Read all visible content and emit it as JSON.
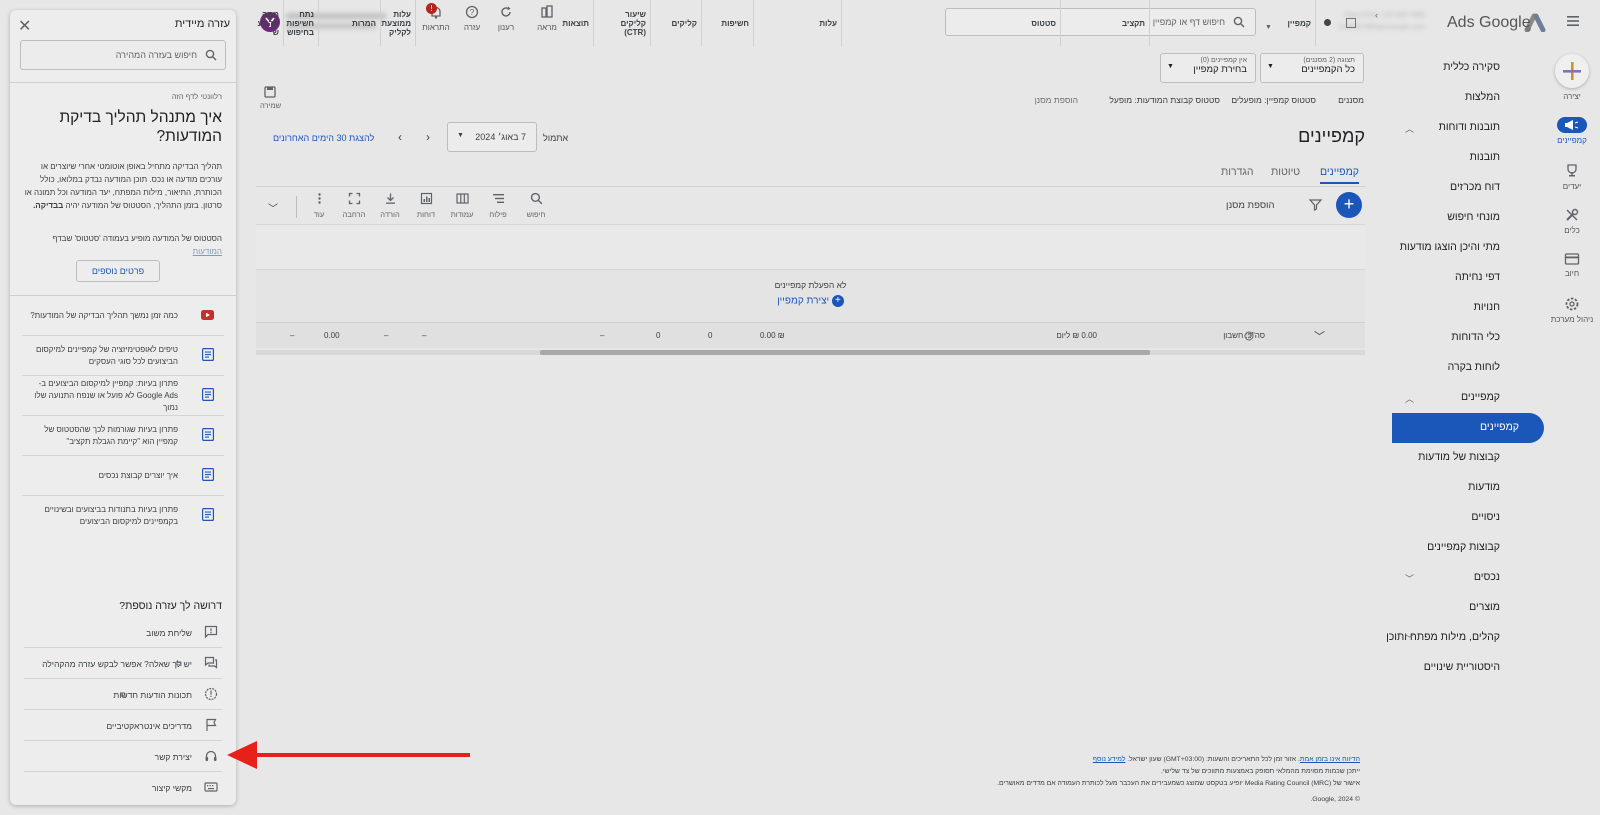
{
  "brand": {
    "name": "Ads Google"
  },
  "account": {
    "masked_line1": "Oreo1234 • 123-456-7890",
    "masked_line2": "1234567890@example.com"
  },
  "search": {
    "placeholder": "חיפוש דף או קמפיין"
  },
  "top_actions": [
    {
      "label": "מראה",
      "icon": "appearance-icon"
    },
    {
      "label": "רענון",
      "icon": "refresh-icon"
    },
    {
      "label": "עזרה",
      "icon": "help-icon"
    },
    {
      "label": "התראות",
      "icon": "bell-icon"
    }
  ],
  "rail": [
    {
      "label": "יצירה",
      "icon": "plus-icon"
    },
    {
      "label": "קמפיינים",
      "icon": "campaigns-icon"
    },
    {
      "label": "יעדים",
      "icon": "trophy-icon"
    },
    {
      "label": "כלים",
      "icon": "tools-icon"
    },
    {
      "label": "חיוב",
      "icon": "card-icon"
    },
    {
      "label": "ניהול מערכת",
      "icon": "gear-icon"
    }
  ],
  "nav": [
    "סקירה כללית",
    "המלצות",
    "תובנות ודוחות",
    "תובנות",
    "דוח מכרזים",
    "מונחי חיפוש",
    "מתי והיכן הוצגו מודעות",
    "דפי נחיתה",
    "חנויות",
    "כלי הדוחות",
    "לוחות בקרה",
    "קמפיינים",
    "קמפיינים",
    "קבוצות של מודעות",
    "מודעות",
    "ניסויים",
    "קבוצות קמפיינים",
    "נכסים",
    "מוצרים",
    "קהלים, מילות מפתח ותוכן",
    "היסטוריית שינויים"
  ],
  "chips": {
    "view_small": "תצוגה (2 מסננים)",
    "view_main": "כל הקמפיינים",
    "campaign_small": "אין קמפיינים (0)",
    "campaign_main": "בחירת קמפיין"
  },
  "filters": {
    "label": "מסננים",
    "f1": "סטטוס קמפיין: מופעלים",
    "f2": "סטטוס קבוצת המודעות: מופעל",
    "add": "הוספת מסנן"
  },
  "save": {
    "label": "שמירה"
  },
  "page": {
    "title": "קמפיינים"
  },
  "date": {
    "label": "אתמול",
    "value": "7 באוג׳ 2024",
    "compare": "להצגת 30 הימים האחרונים"
  },
  "tabs": [
    "קמפיינים",
    "טיוטות",
    "הגדרות"
  ],
  "toolbar": {
    "add_filter": "הוספת מסנן",
    "buttons": [
      "חיפוש",
      "פילוח",
      "עמודות",
      "דוחות",
      "הורדה",
      "הרחבה",
      "עוד"
    ]
  },
  "table": {
    "columns": [
      "קמפיין",
      "תקציב",
      "סטטוס",
      "עלות",
      "חשיפות",
      "קליקים",
      "שיעור קליקים (CTR)",
      "תוצאות",
      "עלות ממוצעת לקליק",
      "המרות",
      "נתח חשיפות בחיפוש",
      "ממה ההתע ש"
    ],
    "empty_text": "לא הפעלת קמפיינים",
    "create_link": "יצירת קמפיין",
    "total": {
      "label": "סה\"כ: חשבון",
      "budget": "0.00 ₪ ליום",
      "cost": "₪ 0.00",
      "impressions": "0",
      "clicks": "0",
      "ctr": "–",
      "results": "–",
      "avg_cpc": "–",
      "conversions": "0.00",
      "impr_share": "–"
    }
  },
  "footer": {
    "line1_link": "הדיווח אינו בזמן אמת",
    "line1": ". אזור זמן לכל התאריכים והשעות: (GMT+03:00) שעון ישראל.",
    "line1_more": "למידע נוסף",
    "line2": "ייתכן שכמות מסוימת מהמלאי תסופק באמצעות מתווכים של צד שלישי.",
    "line3": "אישור של (MRC) Media Rating Council יופיע בטקסט שמוצג כשמעבירים את העכבר מעל לכותרת העמודה אם מדדים מאושרים.",
    "copyright": "© Google, 2024."
  },
  "help": {
    "title": "עזרה מיידית",
    "search_placeholder": "חיפוש בעזרה המהירה",
    "relevant": "רלוונטי לדף הזה",
    "heading": "איך מתנהל תהליך בדיקת המודעות?",
    "body": "תהליך הבדיקה מתחיל באופן אוטומטי אחרי שיוצרים או עורכים מודעה או נכס. תוכן המודעה נבדק במלואו, כולל הכותרת, התיאור, מילות המפתח, יעד המודעה וכל תמונה או סרטון. בזמן התהליך, הסטטוס של המודעה יהיה",
    "body_bold": "בבדיקה.",
    "status_note": "הסטטוס של המודעה מופיע בעמודה 'סטטוס' שבדף",
    "status_link": "המודעות",
    "more_button": "פרטים נוספים",
    "articles": [
      "כמה זמן נמשך תהליך הבדיקה של המודעות?",
      "טיפים לאופטימיזציה של קמפיינים למיקסום הביצועים לכל סוגי העסקים",
      "פתרון בעיות: קמפיין למיקסום הביצועים ב-Google Ads לא פועל או שנפח התנועה שלו נמוך",
      "פתרון בעיות שגורמות לכך שהסטטוס של קמפיין הוא \"קיימת הגבלת תקציב\"",
      "איך יוצרים קבוצת נכסים",
      "פתרון בעיות בתנודות בביצועים ובשינויים בקמפיינים למיקסום הביצועים"
    ],
    "more_title": "דרושה לך עזרה נוספת?",
    "contacts": [
      "שליחת משוב",
      "יש לך שאלה? אפשר לבקש עזרה מהקהילה",
      "תכונות הודעות חדשות",
      "מדריכים אינטראקטיביים",
      "יצירת קשר",
      "מקשי קיצור"
    ]
  },
  "colors": {
    "accent": "#1a57b8",
    "arrow": "#e8201a",
    "background": "#e7e7e7",
    "panel": "#ededed"
  }
}
